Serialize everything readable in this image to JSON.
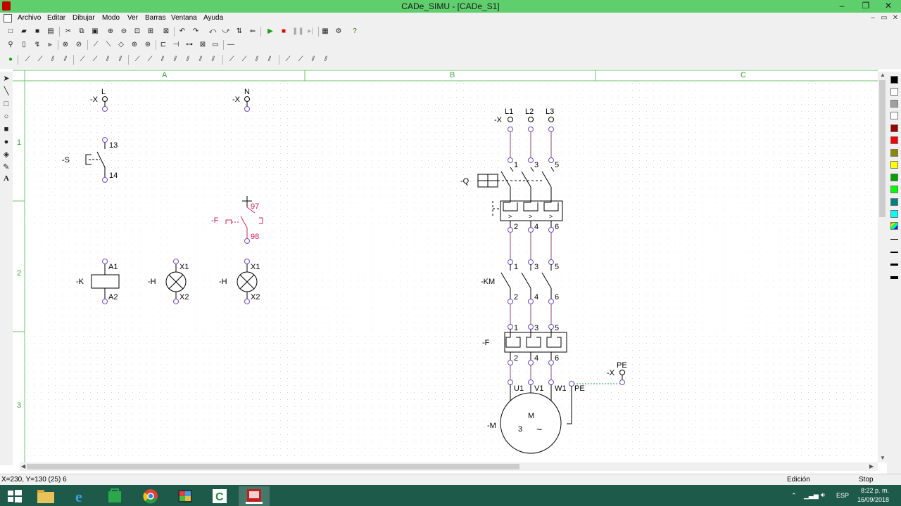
{
  "window": {
    "title": "CADe_SIMU - [CADe_S1]"
  },
  "menu": [
    "Archivo",
    "Editar",
    "Dibujar",
    "Modo",
    "Ver",
    "Barras",
    "Ventana",
    "Ayuda"
  ],
  "sheet": {
    "columns": [
      "A",
      "B",
      "C"
    ],
    "rows": [
      "1",
      "2",
      "3"
    ]
  },
  "schematic": {
    "control": {
      "x_l": {
        "tag": "-X",
        "terminal": "L"
      },
      "x_n": {
        "tag": "-X",
        "terminal": "N"
      },
      "s": {
        "tag": "-S",
        "pin_top": "13",
        "pin_bottom": "14"
      },
      "f": {
        "tag": "-F",
        "pin_top": "97",
        "pin_bottom": "98"
      },
      "k": {
        "tag": "-K",
        "pin_top": "A1",
        "pin_bottom": "A2"
      },
      "h1": {
        "tag": "-H",
        "pin_top": "X1",
        "pin_bottom": "X2"
      },
      "h2": {
        "tag": "-H",
        "pin_top": "X1",
        "pin_bottom": "X2"
      }
    },
    "power": {
      "x_supply": {
        "tag": "-X",
        "lines": [
          "L1",
          "L2",
          "L3"
        ]
      },
      "q": {
        "tag": "-Q",
        "pins_top": [
          "1",
          "3",
          "5"
        ],
        "pins_bottom": [
          "2",
          "4",
          "6"
        ]
      },
      "km": {
        "tag": "-KM",
        "pins_top": [
          "1",
          "3",
          "5"
        ],
        "pins_bottom": [
          "2",
          "4",
          "6"
        ]
      },
      "f_relay": {
        "tag": "-F",
        "pins_top": [
          "1",
          "3",
          "5"
        ],
        "pins_bottom": [
          "2",
          "4",
          "6"
        ]
      },
      "x_pe": {
        "tag": "-X",
        "terminal": "PE"
      },
      "motor": {
        "tag": "-M",
        "terminals": [
          "U1",
          "V1",
          "W1",
          "PE"
        ],
        "label": "M",
        "phases": "3",
        "ac_symbol": "~"
      }
    }
  },
  "status": {
    "coords": "X=230, Y=130 (25) 6",
    "mode": "Edición",
    "sim": "Stop"
  },
  "taskbar": {
    "lang": "ESP",
    "time": "8:22 p. m.",
    "date": "16/09/2018"
  },
  "colors": {
    "titlebar": "#5fce6d",
    "wire_power": "#8b4a6e",
    "pin": "#6b4fc0",
    "highlight": "#cc2255",
    "grid_frame": "#6fc06f"
  },
  "palette_colors": [
    "#000000",
    "#ffffff",
    "#a0a0a0",
    "#ffffff",
    "#9b0000",
    "#ff0000",
    "#8a8a00",
    "#ffff00",
    "#00a000",
    "#00ff00",
    "#008080",
    "#00ffff"
  ]
}
